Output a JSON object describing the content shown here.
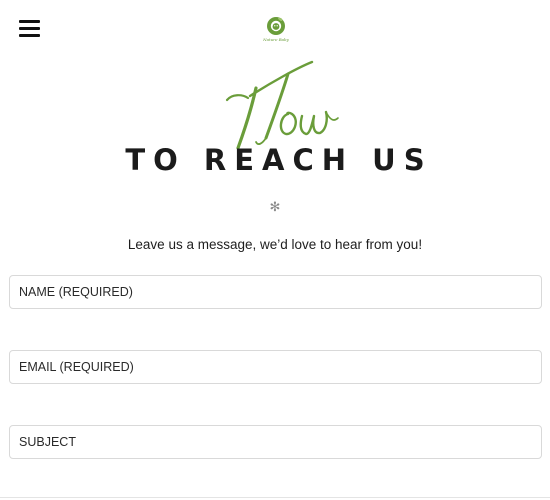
{
  "header": {
    "menu_icon": "hamburger-menu-icon",
    "logo_icon": "leaf-face-logo",
    "logo_text": "Nature Baby"
  },
  "hero": {
    "script_word": "How",
    "heading": "TO REACH US",
    "divider_symbol": "✻",
    "intro": "Leave us a message, we’d love to hear from you!"
  },
  "form": {
    "name_placeholder": "NAME (REQUIRED)",
    "email_placeholder": "EMAIL (REQUIRED)",
    "subject_placeholder": "SUBJECT"
  },
  "colors": {
    "accent": "#6a9d3a",
    "text": "#1e1e1e",
    "border": "#d9d9d9"
  }
}
